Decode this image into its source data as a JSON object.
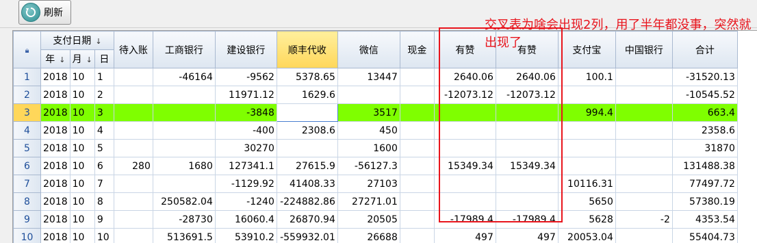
{
  "toolbar": {
    "refresh_label": "刷新"
  },
  "columns": {
    "group_date": "支付日期",
    "year": "年",
    "month": "月",
    "day": "日",
    "pending": "待入账",
    "icbc": "工商银行",
    "ccb": "建设银行",
    "sf": "顺丰代收",
    "wechat": "微信",
    "cash": "现金",
    "youzan1": "有赞",
    "youzan2": "有赞",
    "alipay": "支付宝",
    "boc": "中国银行",
    "total": "合计"
  },
  "rows": [
    {
      "n": "1",
      "y": "2018",
      "m": "10",
      "d": "1",
      "pending": "",
      "icbc": "-46164",
      "ccb": "-9562",
      "sf": "5378.65",
      "wechat": "13447",
      "cash": "",
      "yz1": "2640.06",
      "yz2": "2640.06",
      "alipay": "100.1",
      "boc": "",
      "total": "-31520.13"
    },
    {
      "n": "2",
      "y": "2018",
      "m": "10",
      "d": "2",
      "pending": "",
      "icbc": "",
      "ccb": "11971.12",
      "sf": "1629.6",
      "wechat": "",
      "cash": "",
      "yz1": "-12073.12",
      "yz2": "-12073.12",
      "alipay": "",
      "boc": "",
      "total": "-10545.52"
    },
    {
      "n": "3",
      "y": "2018",
      "m": "10",
      "d": "3",
      "pending": "",
      "icbc": "",
      "ccb": "-3848",
      "sf": "",
      "wechat": "3517",
      "cash": "",
      "yz1": "",
      "yz2": "",
      "alipay": "994.4",
      "boc": "",
      "total": "663.4"
    },
    {
      "n": "4",
      "y": "2018",
      "m": "10",
      "d": "4",
      "pending": "",
      "icbc": "",
      "ccb": "-400",
      "sf": "2308.6",
      "wechat": "450",
      "cash": "",
      "yz1": "",
      "yz2": "",
      "alipay": "",
      "boc": "",
      "total": "2358.6"
    },
    {
      "n": "5",
      "y": "2018",
      "m": "10",
      "d": "5",
      "pending": "",
      "icbc": "",
      "ccb": "30270",
      "sf": "",
      "wechat": "1600",
      "cash": "",
      "yz1": "",
      "yz2": "",
      "alipay": "",
      "boc": "",
      "total": "31870"
    },
    {
      "n": "6",
      "y": "2018",
      "m": "10",
      "d": "6",
      "pending": "280",
      "icbc": "1680",
      "ccb": "127341.1",
      "sf": "27615.9",
      "wechat": "-56127.3",
      "cash": "",
      "yz1": "15349.34",
      "yz2": "15349.34",
      "alipay": "",
      "boc": "",
      "total": "131488.38"
    },
    {
      "n": "7",
      "y": "2018",
      "m": "10",
      "d": "7",
      "pending": "",
      "icbc": "",
      "ccb": "-1129.92",
      "sf": "41408.33",
      "wechat": "27103",
      "cash": "",
      "yz1": "",
      "yz2": "",
      "alipay": "10116.31",
      "boc": "",
      "total": "77497.72"
    },
    {
      "n": "8",
      "y": "2018",
      "m": "10",
      "d": "8",
      "pending": "",
      "icbc": "250582.04",
      "ccb": "-1240",
      "sf": "-224882.86",
      "wechat": "27271.01",
      "cash": "",
      "yz1": "",
      "yz2": "",
      "alipay": "5650",
      "boc": "",
      "total": "57380.19"
    },
    {
      "n": "9",
      "y": "2018",
      "m": "10",
      "d": "9",
      "pending": "",
      "icbc": "-28730",
      "ccb": "16060.4",
      "sf": "26870.94",
      "wechat": "20505",
      "cash": "",
      "yz1": "-17989.4",
      "yz2": "-17989.4",
      "alipay": "5628",
      "boc": "-2",
      "total": "4353.54"
    },
    {
      "n": "10",
      "y": "2018",
      "m": "10",
      "d": "10",
      "pending": "",
      "icbc": "513691.5",
      "ccb": "53910.2",
      "sf": "-559932.01",
      "wechat": "26688",
      "cash": "",
      "yz1": "497",
      "yz2": "497",
      "alipay": "20053.04",
      "boc": "",
      "total": "55404.73"
    }
  ],
  "annotation": {
    "text": "交叉表为啥会出现2列，用了半年都没事，突然就出现了",
    "color": "#e8141c"
  },
  "colors": {
    "selected_row": "#7fff00",
    "highlight_header": "#ffd75a",
    "annotation": "#e8141c"
  }
}
